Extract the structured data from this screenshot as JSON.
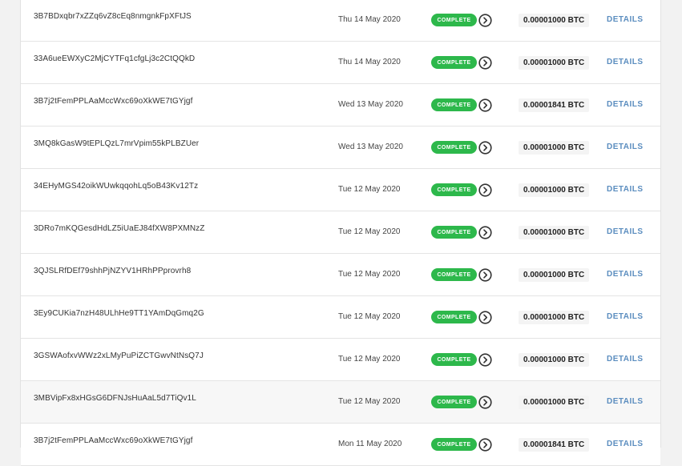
{
  "colors": {
    "badge": "#2db84b",
    "details_link": "#5b8dbf",
    "row_divider": "#e4e4e4"
  },
  "status_icon": "chevron-right-circle-icon",
  "transactions": [
    {
      "address": "3B7BDxqbr7xZZq6vZ8cEq8nmgnkFpXFtJS",
      "date": "Thu 14 May 2020",
      "status": "COMPLETE",
      "amount": "0.00001000 BTC",
      "action": "DETAILS"
    },
    {
      "address": "33A6ueEWXyC2MjCYTFq1cfgLj3c2CtQQkD",
      "date": "Thu 14 May 2020",
      "status": "COMPLETE",
      "amount": "0.00001000 BTC",
      "action": "DETAILS"
    },
    {
      "address": "3B7j2tFemPPLAaMccWxc69oXkWE7tGYjgf",
      "date": "Wed 13 May 2020",
      "status": "COMPLETE",
      "amount": "0.00001841 BTC",
      "action": "DETAILS"
    },
    {
      "address": "3MQ8kGasW9tEPLQzL7mrVpim55kPLBZUer",
      "date": "Wed 13 May 2020",
      "status": "COMPLETE",
      "amount": "0.00001000 BTC",
      "action": "DETAILS"
    },
    {
      "address": "34EHyMGS42oikWUwkqqohLq5oB43Kv12Tz",
      "date": "Tue 12 May 2020",
      "status": "COMPLETE",
      "amount": "0.00001000 BTC",
      "action": "DETAILS"
    },
    {
      "address": "3DRo7mKQGesdHdLZ5iUaEJ84fXW8PXMNzZ",
      "date": "Tue 12 May 2020",
      "status": "COMPLETE",
      "amount": "0.00001000 BTC",
      "action": "DETAILS"
    },
    {
      "address": "3QJSLRfDEf79shhPjNZYV1HRhPPprovrh8",
      "date": "Tue 12 May 2020",
      "status": "COMPLETE",
      "amount": "0.00001000 BTC",
      "action": "DETAILS"
    },
    {
      "address": "3Ey9CUKia7nzH48ULhHe9TT1YAmDqGmq2G",
      "date": "Tue 12 May 2020",
      "status": "COMPLETE",
      "amount": "0.00001000 BTC",
      "action": "DETAILS"
    },
    {
      "address": "3GSWAofxvWWz2xLMyPuPiZCTGwvNtNsQ7J",
      "date": "Tue 12 May 2020",
      "status": "COMPLETE",
      "amount": "0.00001000 BTC",
      "action": "DETAILS"
    },
    {
      "address": "3MBVipFx8xHGsG6DFNJsHuAaL5d7TiQv1L",
      "date": "Tue 12 May 2020",
      "status": "COMPLETE",
      "amount": "0.00001000 BTC",
      "action": "DETAILS"
    },
    {
      "address": "3B7j2tFemPPLAaMccWxc69oXkWE7tGYjgf",
      "date": "Mon 11 May 2020",
      "status": "COMPLETE",
      "amount": "0.00001841 BTC",
      "action": "DETAILS"
    }
  ]
}
